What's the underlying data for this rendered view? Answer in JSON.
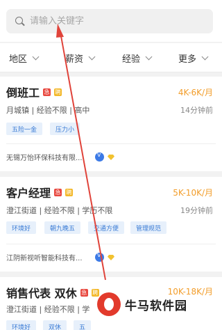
{
  "search": {
    "placeholder": "请输入关键字"
  },
  "filters": [
    {
      "label": "地区"
    },
    {
      "label": "薪资"
    },
    {
      "label": "经验"
    },
    {
      "label": "更多"
    }
  ],
  "jobs": [
    {
      "title": "倒班工",
      "salary": "4K-6K/月",
      "meta": "月城镇 | 经验不限 | 高中",
      "time": "14分钟前",
      "tags": [
        "五险一金",
        "压力小"
      ],
      "company": "无锡万怡环保科技有限..."
    },
    {
      "title": "客户经理",
      "salary": "5K-10K/月",
      "meta": "澄江街道 | 经验不限 | 学历不限",
      "time": "19分钟前",
      "tags": [
        "环境好",
        "朝九晚五",
        "交通方便",
        "管理规范"
      ],
      "company": "江阴新视听智能科技有..."
    },
    {
      "title": "销售代表 双休",
      "salary": "10K-18K/月",
      "meta": "澄江街道 | 经验不限 | 学",
      "time": "",
      "tags": [
        "环境好",
        "双休",
        "五"
      ],
      "company": ""
    }
  ],
  "badges": {
    "red": "急",
    "gold": "聘"
  },
  "watermark": {
    "text": "牛马软件园"
  },
  "colors": {
    "salary": "#f29d2a",
    "tag_text": "#3a7bd5",
    "tag_bg": "#e7f0fb",
    "annotation_arrow": "#e0433a"
  }
}
